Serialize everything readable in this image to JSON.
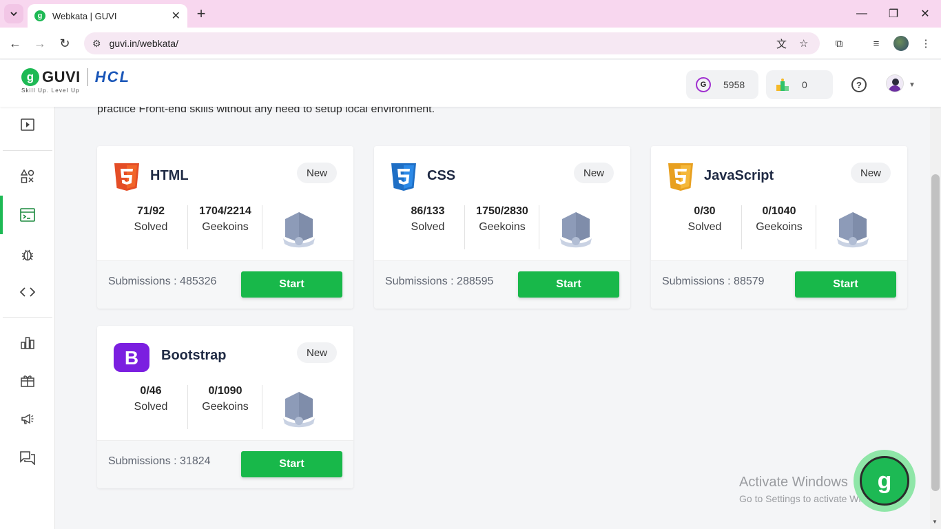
{
  "browser": {
    "tab_title": "Webkata | GUVI",
    "url": "guvi.in/webkata/"
  },
  "header": {
    "brand": "GUVI",
    "partner": "HCL",
    "tagline": "Skill Up. Level Up",
    "geekoins": "5958",
    "rank": "0"
  },
  "intro_text": "practice Front-end skills without any need to setup local environment.",
  "sidebar": {
    "items": [
      "play-icon",
      "shapes-icon",
      "webkata-icon",
      "bug-icon",
      "code-icon",
      "leaderboard-icon",
      "gift-icon",
      "announce-icon",
      "forum-icon"
    ],
    "active": "webkata-icon"
  },
  "cards": [
    {
      "name": "HTML",
      "badge": "New",
      "solved": "71/92",
      "solved_label": "Solved",
      "geekoins": "1704/2214",
      "geekoins_label": "Geekoins",
      "submissions": "Submissions : 485326",
      "button": "Start"
    },
    {
      "name": "CSS",
      "badge": "New",
      "solved": "86/133",
      "solved_label": "Solved",
      "geekoins": "1750/2830",
      "geekoins_label": "Geekoins",
      "submissions": "Submissions : 288595",
      "button": "Start"
    },
    {
      "name": "JavaScript",
      "badge": "New",
      "solved": "0/30",
      "solved_label": "Solved",
      "geekoins": "0/1040",
      "geekoins_label": "Geekoins",
      "submissions": "Submissions : 88579",
      "button": "Start"
    },
    {
      "name": "Bootstrap",
      "badge": "New",
      "solved": "0/46",
      "solved_label": "Solved",
      "geekoins": "0/1090",
      "geekoins_label": "Geekoins",
      "submissions": "Submissions : 31824",
      "button": "Start"
    }
  ],
  "watermark": {
    "line1": "Activate Windows",
    "line2": "Go to Settings to activate Windows."
  },
  "colors": {
    "accent": "#18b84a",
    "html": "#e44d26",
    "css": "#1f6fc5",
    "js": "#f0a92a",
    "bootstrap": "#7b1fe0"
  }
}
